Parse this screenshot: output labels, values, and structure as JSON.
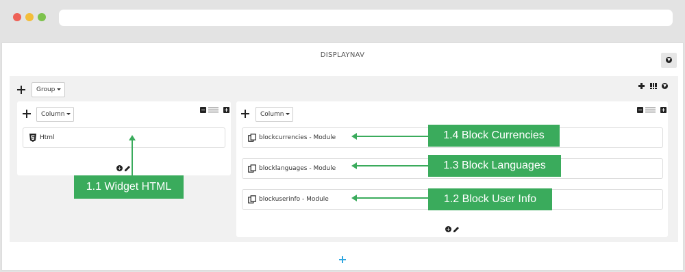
{
  "hook": {
    "title": "DISPLAYNAV"
  },
  "group": {
    "dropdown_label": "Group"
  },
  "columns": [
    {
      "dropdown_label": "Column"
    },
    {
      "dropdown_label": "Column"
    }
  ],
  "modules": {
    "html": "Html",
    "currencies": "blockcurrencies - Module",
    "languages": "blocklanguages - Module",
    "userinfo": "blockuserinfo - Module"
  },
  "annotations": {
    "widget_html": "1.1 Widget HTML",
    "block_user_info": "1.2 Block User Info",
    "block_languages": "1.3 Block Languages",
    "block_currencies": "1.4 Block Currencies"
  },
  "colors": {
    "annotation": "#3aab5c",
    "add_hook": "#2fa6e0"
  },
  "icons": {
    "move": "move-icon",
    "add": "plus-icon",
    "grid": "grid-icon",
    "toggle": "circle-down-icon",
    "collapse": "minus-icon",
    "expand": "plus-icon",
    "html5": "html5-icon",
    "module": "module-copy-icon",
    "edit": "pencil-icon"
  }
}
